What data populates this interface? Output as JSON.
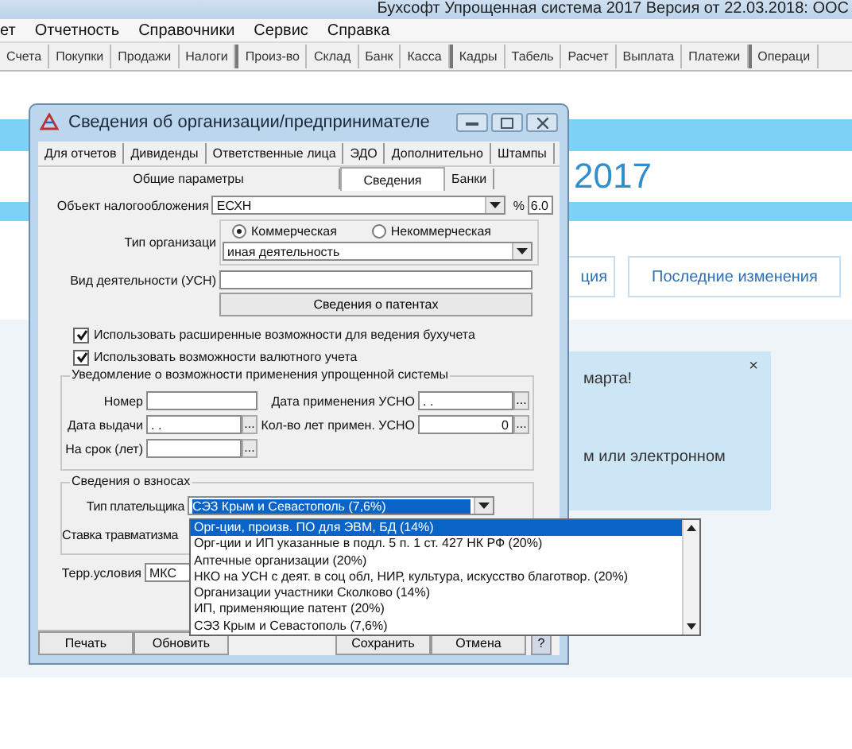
{
  "window": {
    "title": "Бухсофт Упрощенная система 2017 Версия от 22.03.2018: ООС"
  },
  "menu": [
    "ет",
    "Отчетность",
    "Справочники",
    "Сервис",
    "Справка"
  ],
  "toolbar": {
    "groups": [
      [
        "Счета",
        "Покупки",
        "Продажи",
        "Налоги"
      ],
      [
        "Произ-во",
        "Склад",
        "Банк",
        "Касса"
      ],
      [
        "Кадры",
        "Табель",
        "Расчет",
        "Выплата",
        "Платежи"
      ],
      [
        "Операци"
      ]
    ]
  },
  "web": {
    "heading": "2017",
    "tab_buttons": [
      "ция",
      "Последние изменения"
    ],
    "notice": {
      "close": "×",
      "lines": [
        "марта!",
        "м или электронном"
      ]
    }
  },
  "dialog": {
    "title": "Сведения об организации/предпринимателе",
    "tabs_row1": [
      {
        "label": "Для отчетов",
        "selected": false
      },
      {
        "label": "Дивиденды",
        "selected": false
      },
      {
        "label": "Ответственные лица",
        "selected": false
      },
      {
        "label": "ЭДО",
        "selected": false
      },
      {
        "label": "Дополнительно",
        "selected": false
      },
      {
        "label": "Штампы",
        "selected": false
      }
    ],
    "tabs_row2": [
      {
        "label": "Общие параметры",
        "selected": false
      },
      {
        "label": "Сведения",
        "selected": true
      },
      {
        "label": "Банки",
        "selected": false
      }
    ],
    "tax_object": {
      "label": "Объект налогообложения",
      "value": "ЕСХН",
      "percent_label": "%",
      "percent": "6.0"
    },
    "org_type": {
      "label": "Тип организаци",
      "options": [
        {
          "label": "Коммерческая",
          "selected": true
        },
        {
          "label": "Некоммерческая",
          "selected": false
        }
      ],
      "activity": "иная деятельность"
    },
    "activity_usn": {
      "label": "Вид деятельности (УСН)"
    },
    "patents_button": "Сведения о патентах",
    "checkboxes": [
      {
        "label": "Использовать расширенные возможности для ведения бухучета",
        "checked": true
      },
      {
        "label": "Использовать возможности валютного учета",
        "checked": true
      }
    ],
    "notice_group": {
      "title": "Уведомление о возможности применения упрощенной системы",
      "rows": [
        [
          {
            "label": "Номер"
          },
          {
            "label": "Дата применения УСНО",
            "value": ". .",
            "button": "..."
          }
        ],
        [
          {
            "label": "Дата выдачи",
            "value": ". .",
            "button": "..."
          },
          {
            "label": "Кол-во лет примен. УСНО",
            "value": "0",
            "button": "..."
          }
        ],
        [
          {
            "label": "На срок (лет)",
            "button": "..."
          }
        ]
      ]
    },
    "contrib_group": {
      "title": "Сведения о взносах",
      "payer_label": "Тип плательщика",
      "payer": "СЭЗ Крым и Севастополь (7,6%)",
      "injury_label": "Ставка травматизма"
    },
    "terr": {
      "label": "Терр.условия",
      "value": "МКС"
    },
    "buttons": {
      "left": [
        "Печать",
        "Обновить"
      ],
      "right": [
        "Сохранить",
        "Отмена"
      ],
      "help": "?"
    },
    "payer_list": [
      {
        "label": "Орг-ции, произв. ПО для ЭВМ, БД (14%)",
        "selected": true
      },
      {
        "label": "Орг-ции и ИП указанные в подл. 5 п. 1 ст. 427 НК РФ (20%)",
        "selected": false
      },
      {
        "label": "Аптечные организации (20%)",
        "selected": false
      },
      {
        "label": "НКО на УСН с деят. в соц обл, НИР, культура, искусство благотвор. (20%)",
        "selected": false
      },
      {
        "label": "Организации участники Сколково (14%)",
        "selected": false
      },
      {
        "label": "ИП, применяющие патент (20%)",
        "selected": false
      },
      {
        "label": "СЭЗ Крым и Севастополь (7,6%)",
        "selected": false
      }
    ]
  }
}
